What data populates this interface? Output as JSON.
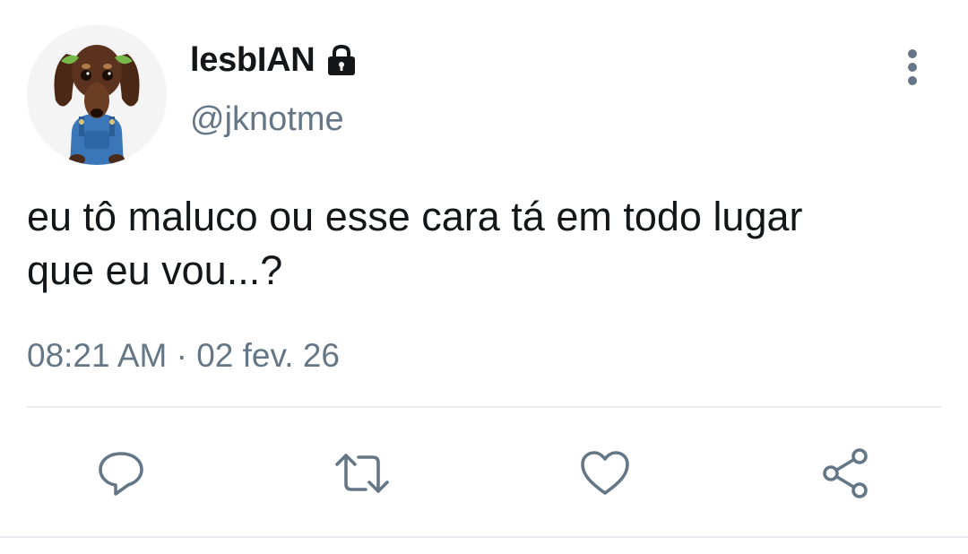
{
  "user": {
    "display_name": "lesbIAN",
    "username": "@jknotme",
    "protected": true,
    "avatar": "dachshund-avatar"
  },
  "tweet": {
    "text": "eu tô maluco ou esse cara tá em todo lugar\nque eu vou...?",
    "timestamp": "08:21 AM · 02 fev. 26"
  },
  "icons": {
    "more": "more-vertical-icon",
    "reply": "reply-icon",
    "retweet": "retweet-icon",
    "like": "heart-icon",
    "share": "share-icon"
  },
  "colors": {
    "text_primary": "#14171a",
    "text_secondary": "#657786",
    "divider": "#e6ecf0"
  }
}
